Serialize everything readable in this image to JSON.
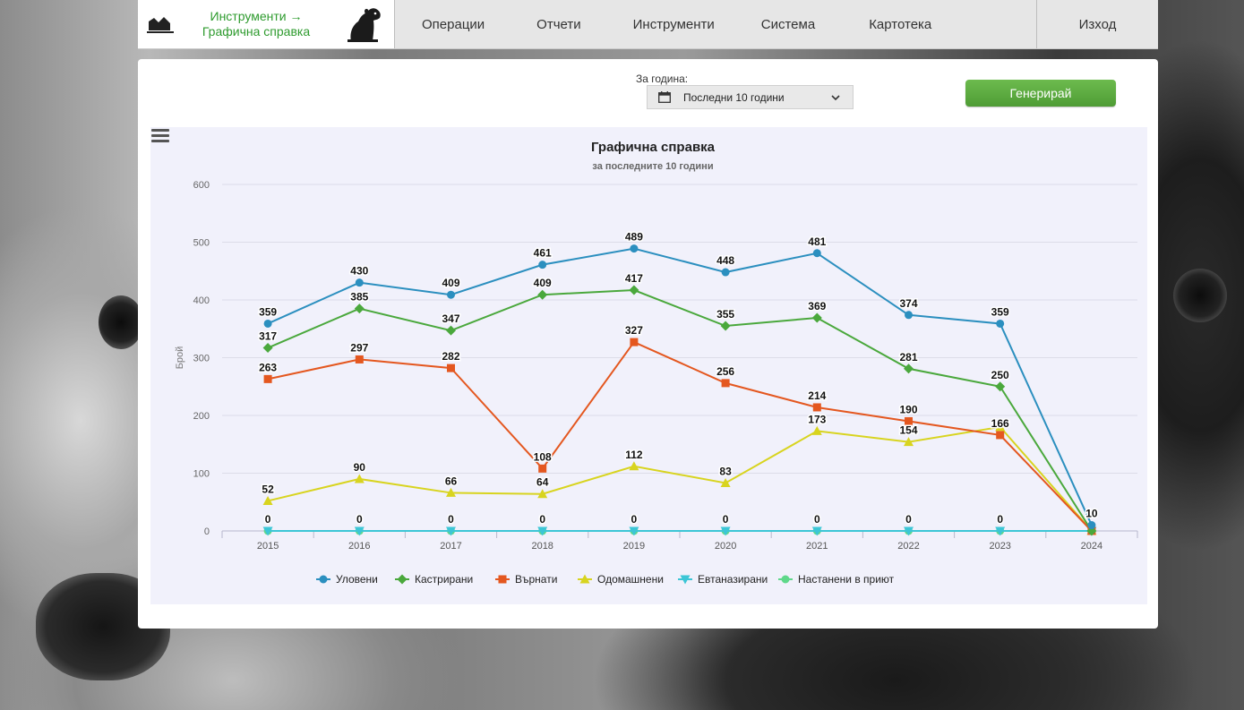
{
  "nav": {
    "breadcrumb_line1": "Инструменти →",
    "breadcrumb_line2": "Графична справка",
    "items": [
      "Операции",
      "Отчети",
      "Инструменти",
      "Система",
      "Картотека"
    ],
    "logout": "Изход"
  },
  "filter": {
    "year_label": "За година:",
    "selected": "Последни 10 години",
    "generate": "Генерирай"
  },
  "colors": {
    "brand_green": "#2e9b2e",
    "button_green": "#5aa83e"
  },
  "chart_data": {
    "type": "line",
    "title": "Графична справка",
    "subtitle": "за последните 10 години",
    "ylabel": "Брой",
    "xlabel": "",
    "ylim": [
      0,
      600
    ],
    "yticks": [
      0,
      100,
      200,
      300,
      400,
      500,
      600
    ],
    "categories": [
      "2015",
      "2016",
      "2017",
      "2018",
      "2019",
      "2020",
      "2021",
      "2022",
      "2023",
      "2024"
    ],
    "legend_position": "bottom",
    "series": [
      {
        "name": "Уловени",
        "color": "#2b8fbf",
        "marker": "circle",
        "values": [
          359,
          430,
          409,
          461,
          489,
          448,
          481,
          374,
          359,
          10
        ],
        "labels": [
          true,
          true,
          true,
          true,
          true,
          true,
          true,
          true,
          true,
          true
        ]
      },
      {
        "name": "Кастрирани",
        "color": "#4aa83c",
        "marker": "diamond",
        "values": [
          317,
          385,
          347,
          409,
          417,
          355,
          369,
          281,
          250,
          0
        ],
        "labels": [
          true,
          true,
          true,
          true,
          true,
          true,
          true,
          true,
          true,
          false
        ]
      },
      {
        "name": "Върнати",
        "color": "#e4571f",
        "marker": "square",
        "values": [
          263,
          297,
          282,
          108,
          327,
          256,
          214,
          190,
          166,
          0
        ],
        "labels": [
          true,
          true,
          true,
          true,
          true,
          true,
          true,
          true,
          true,
          false
        ]
      },
      {
        "name": "Одомашнени",
        "color": "#d8d41f",
        "marker": "triangle",
        "values": [
          52,
          90,
          66,
          64,
          112,
          83,
          173,
          154,
          180,
          0
        ],
        "labels": [
          true,
          true,
          true,
          true,
          true,
          true,
          true,
          true,
          false,
          false
        ]
      },
      {
        "name": "Евтаназирани",
        "color": "#3cc6d6",
        "marker": "triangle-down",
        "values": [
          0,
          0,
          0,
          0,
          0,
          0,
          0,
          0,
          0,
          0
        ],
        "labels": [
          false,
          false,
          false,
          false,
          false,
          false,
          false,
          false,
          false,
          false
        ]
      },
      {
        "name": "Настанени в приют",
        "color": "#5fd88a",
        "marker": "circle",
        "values": [
          0,
          0,
          0,
          0,
          0,
          0,
          0,
          0,
          0,
          0
        ],
        "labels": [
          true,
          true,
          true,
          true,
          true,
          true,
          true,
          true,
          true,
          false
        ]
      }
    ]
  }
}
